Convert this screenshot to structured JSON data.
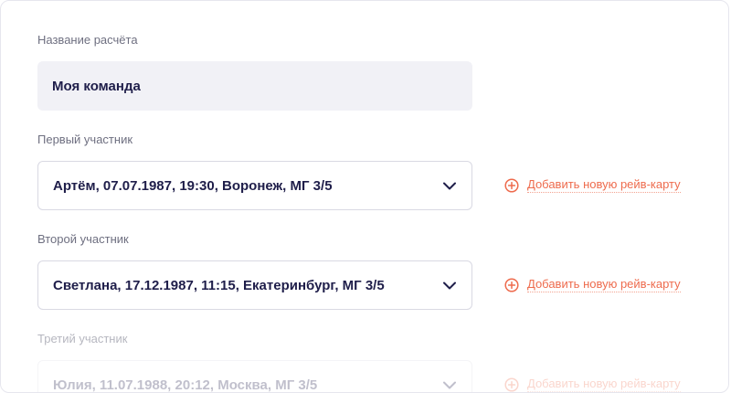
{
  "form": {
    "name_label": "Название расчёта",
    "name_value": "Моя команда",
    "add_link_label": "Добавить новую рейв-карту",
    "participants": [
      {
        "label": "Первый участник",
        "value": "Артём, 07.07.1987, 19:30, Воронеж, МГ 3/5"
      },
      {
        "label": "Второй участник",
        "value": "Светлана, 17.12.1987, 11:15, Екатеринбург, МГ 3/5"
      },
      {
        "label": "Третий участник",
        "value": "Юлия, 11.07.1988, 20:12, Москва, МГ 3/5"
      }
    ]
  },
  "colors": {
    "text_primary": "#1f1e4a",
    "text_label": "#6e6f80",
    "accent": "#ee6b4d",
    "field_bg": "#f1f1f6",
    "border": "#d9d9e3"
  },
  "icons": {
    "dropdown": "chevron-down-icon",
    "add": "plus-circle-icon"
  }
}
